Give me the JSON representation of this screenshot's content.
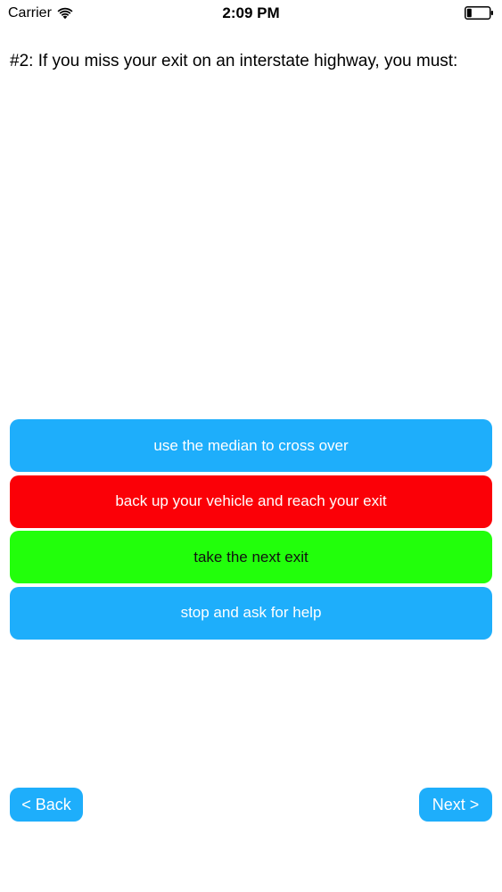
{
  "status_bar": {
    "carrier": "Carrier",
    "time": "2:09 PM"
  },
  "question": {
    "text": "#2: If you miss your exit on an interstate highway, you must:"
  },
  "answers": [
    {
      "label": "use the median to cross over",
      "state": "neutral",
      "color": "#1eaefb"
    },
    {
      "label": "back up your vehicle and reach your exit",
      "state": "incorrect",
      "color": "#fb0007"
    },
    {
      "label": "take the next exit",
      "state": "correct",
      "color": "#22ff0b"
    },
    {
      "label": "stop and ask for help",
      "state": "neutral",
      "color": "#1eaefb"
    }
  ],
  "nav": {
    "back_label": "< Back",
    "next_label": "Next >"
  },
  "colors": {
    "accent": "#1eaefb",
    "incorrect": "#fb0007",
    "correct": "#22ff0b"
  }
}
